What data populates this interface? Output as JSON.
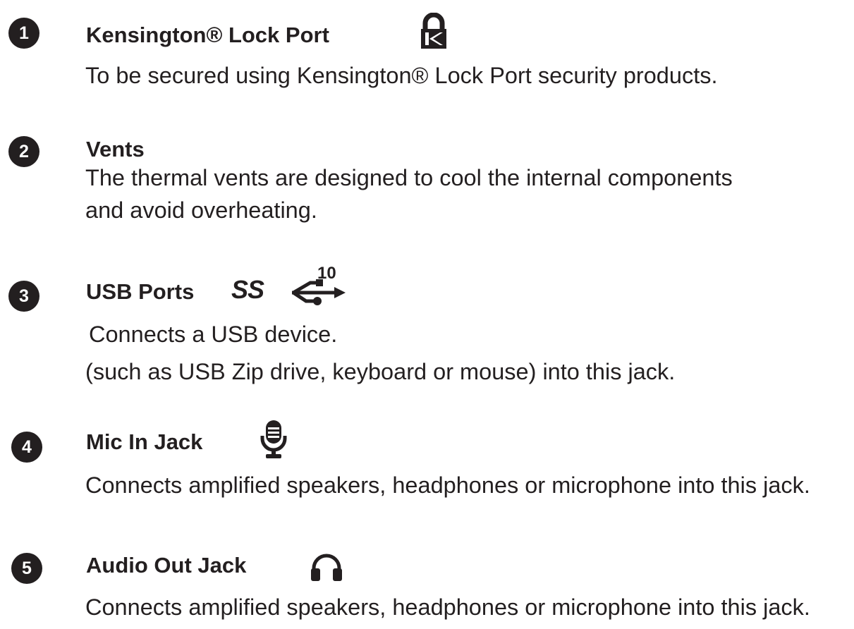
{
  "items": [
    {
      "number": "1",
      "title": "Kensington® Lock Port",
      "icon": "kensington-lock-icon",
      "description": [
        "To be secured using Kensington® Lock Port security products."
      ]
    },
    {
      "number": "2",
      "title": "Vents",
      "icon": "",
      "description": [
        "The thermal vents are designed to cool the internal components",
        "and avoid overheating."
      ]
    },
    {
      "number": "3",
      "title": "USB Ports",
      "icon": "usb-superspeed-10-icon",
      "icon_text": {
        "ss": "SS",
        "speed": "10"
      },
      "description": [
        "Connects a USB device.",
        "(such as USB Zip drive, keyboard or mouse) into this jack."
      ]
    },
    {
      "number": "4",
      "title": "Mic In Jack",
      "icon": "microphone-icon",
      "description": [
        "Connects amplified speakers, headphones or microphone into this jack."
      ]
    },
    {
      "number": "5",
      "title": "Audio Out Jack",
      "icon": "headphones-icon",
      "description": [
        "Connects amplified speakers, headphones or microphone into this jack."
      ]
    }
  ],
  "colors": {
    "text": "#231f20",
    "badge_background": "#231f20",
    "badge_text": "#ffffff",
    "page_background": "#ffffff"
  }
}
